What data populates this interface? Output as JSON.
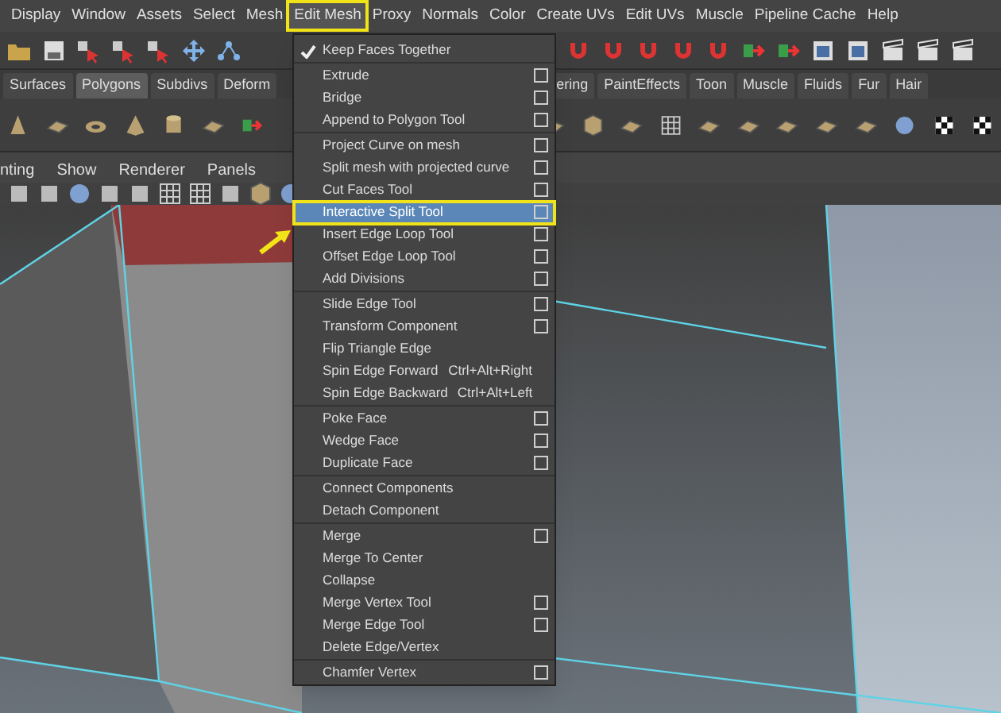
{
  "menu_bar": [
    {
      "label": "Display",
      "selected": false
    },
    {
      "label": "Window",
      "selected": false
    },
    {
      "label": "Assets",
      "selected": false
    },
    {
      "label": "Select",
      "selected": false
    },
    {
      "label": "Mesh",
      "selected": false
    },
    {
      "label": "Edit Mesh",
      "selected": true
    },
    {
      "label": "Proxy",
      "selected": false
    },
    {
      "label": "Normals",
      "selected": false
    },
    {
      "label": "Color",
      "selected": false
    },
    {
      "label": "Create UVs",
      "selected": false
    },
    {
      "label": "Edit UVs",
      "selected": false
    },
    {
      "label": "Muscle",
      "selected": false
    },
    {
      "label": "Pipeline Cache",
      "selected": false
    },
    {
      "label": "Help",
      "selected": false
    }
  ],
  "shelf_tabs": [
    {
      "label": "Surfaces",
      "selected": false
    },
    {
      "label": "Polygons",
      "selected": true
    },
    {
      "label": "Subdivs",
      "selected": false
    },
    {
      "label": "Deform",
      "selected": false
    },
    {
      "label": "ering",
      "selected": false
    },
    {
      "label": "PaintEffects",
      "selected": false
    },
    {
      "label": "Toon",
      "selected": false
    },
    {
      "label": "Muscle",
      "selected": false
    },
    {
      "label": "Fluids",
      "selected": false
    },
    {
      "label": "Fur",
      "selected": false
    },
    {
      "label": "Hair",
      "selected": false
    }
  ],
  "panel_menu": [
    "nting",
    "Show",
    "Renderer",
    "Panels"
  ],
  "dropdown": {
    "groups": [
      [
        {
          "kind": "check",
          "label": "Keep Faces Together",
          "checked": true
        }
      ],
      [
        {
          "kind": "option",
          "label": "Extrude",
          "selected": false
        },
        {
          "kind": "option",
          "label": "Bridge",
          "selected": false
        },
        {
          "kind": "option",
          "label": "Append to Polygon Tool",
          "selected": false
        }
      ],
      [
        {
          "kind": "option",
          "label": "Project Curve on mesh",
          "selected": false
        },
        {
          "kind": "option",
          "label": "Split mesh with projected curve",
          "selected": false
        },
        {
          "kind": "option",
          "label": "Cut Faces Tool",
          "selected": false
        },
        {
          "kind": "option",
          "label": "Interactive Split Tool",
          "selected": true
        },
        {
          "kind": "option",
          "label": "Insert Edge Loop Tool",
          "selected": false
        },
        {
          "kind": "option",
          "label": "Offset Edge Loop Tool",
          "selected": false
        },
        {
          "kind": "option",
          "label": "Add Divisions",
          "selected": false
        }
      ],
      [
        {
          "kind": "option",
          "label": "Slide Edge Tool",
          "selected": false
        },
        {
          "kind": "option",
          "label": "Transform Component",
          "selected": false
        },
        {
          "kind": "plain",
          "label": "Flip Triangle Edge",
          "selected": false
        },
        {
          "kind": "shortcut",
          "label": "Spin Edge Forward",
          "shortcut": "Ctrl+Alt+Right",
          "selected": false
        },
        {
          "kind": "shortcut",
          "label": "Spin Edge Backward",
          "shortcut": "Ctrl+Alt+Left",
          "selected": false
        }
      ],
      [
        {
          "kind": "option",
          "label": "Poke Face",
          "selected": false
        },
        {
          "kind": "option",
          "label": "Wedge Face",
          "selected": false
        },
        {
          "kind": "option",
          "label": "Duplicate Face",
          "selected": false
        }
      ],
      [
        {
          "kind": "plain",
          "label": "Connect Components",
          "selected": false
        },
        {
          "kind": "plain",
          "label": "Detach Component",
          "selected": false
        }
      ],
      [
        {
          "kind": "option",
          "label": "Merge",
          "selected": false
        },
        {
          "kind": "plain",
          "label": "Merge To Center",
          "selected": false
        },
        {
          "kind": "plain",
          "label": "Collapse",
          "selected": false
        },
        {
          "kind": "option",
          "label": "Merge Vertex Tool",
          "selected": false
        },
        {
          "kind": "option",
          "label": "Merge Edge Tool",
          "selected": false
        },
        {
          "kind": "plain",
          "label": "Delete Edge/Vertex",
          "selected": false
        }
      ],
      [
        {
          "kind": "option",
          "label": "Chamfer Vertex",
          "selected": false
        }
      ]
    ]
  }
}
